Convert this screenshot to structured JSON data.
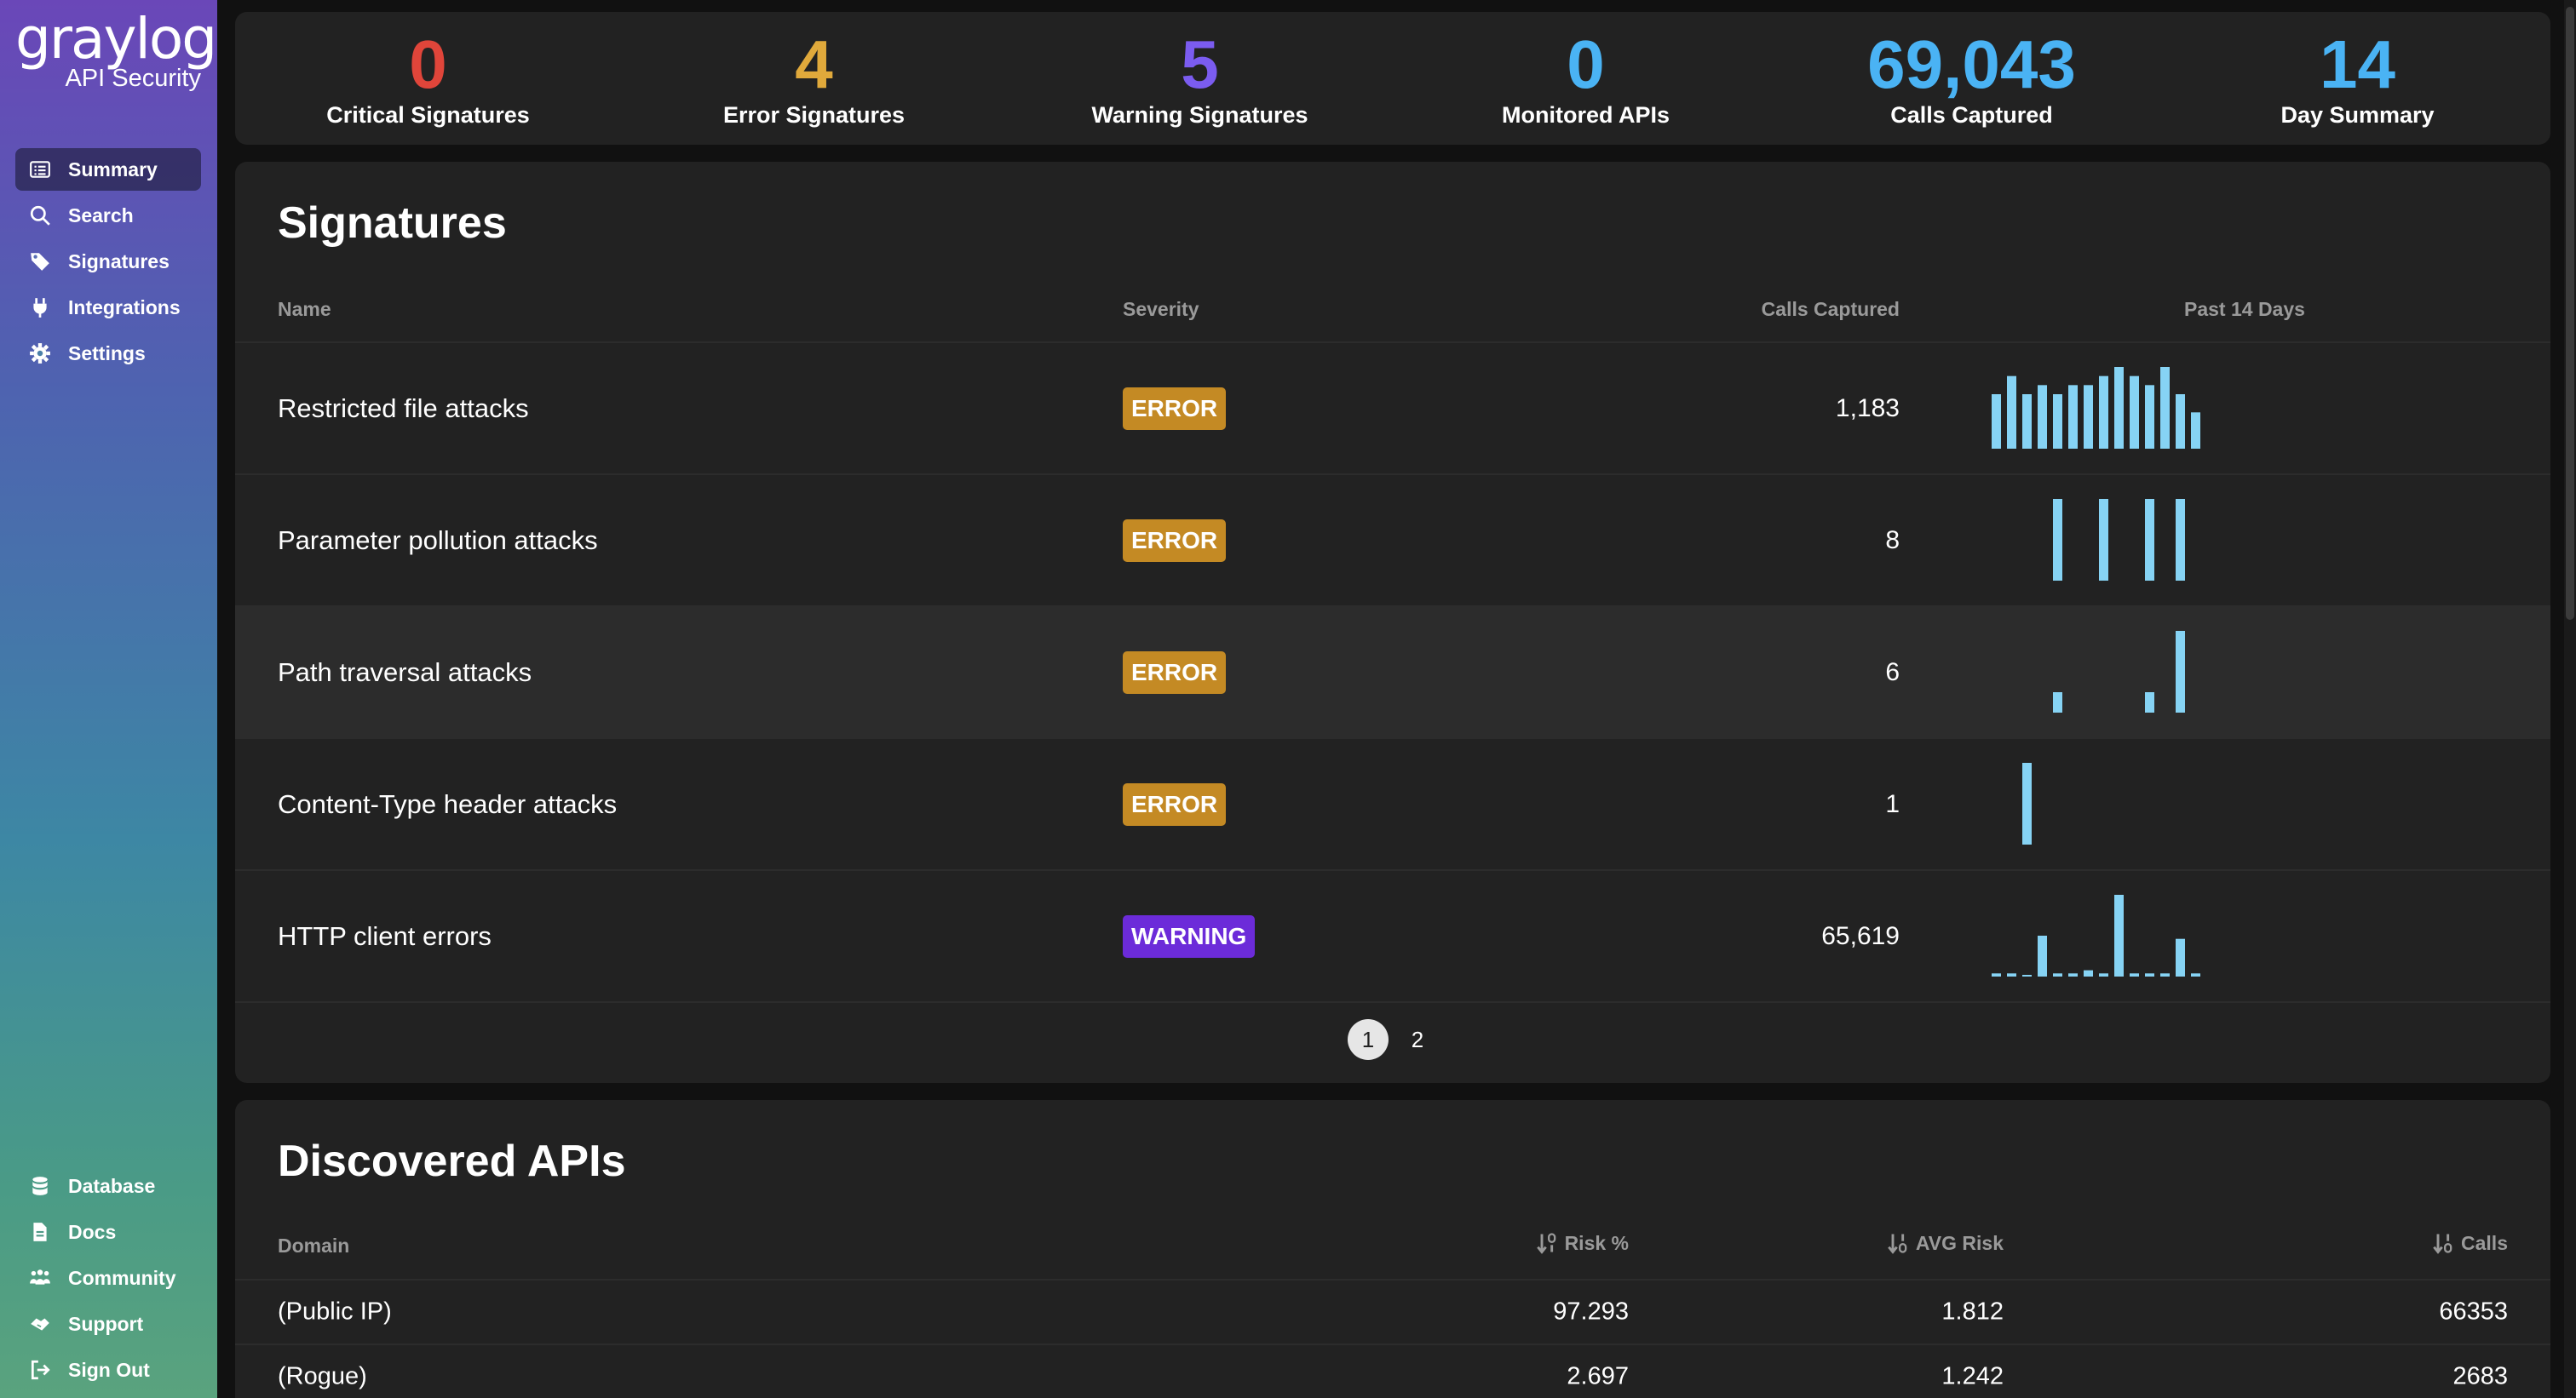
{
  "brand": {
    "name": "graylog",
    "product": "API Security"
  },
  "nav": {
    "top": [
      {
        "label": "Summary",
        "icon": "summary-icon",
        "active": true
      },
      {
        "label": "Search",
        "icon": "search-icon",
        "active": false
      },
      {
        "label": "Signatures",
        "icon": "tag-icon",
        "active": false
      },
      {
        "label": "Integrations",
        "icon": "plug-icon",
        "active": false
      },
      {
        "label": "Settings",
        "icon": "gear-icon",
        "active": false
      }
    ],
    "bottom": [
      {
        "label": "Database",
        "icon": "database-icon"
      },
      {
        "label": "Docs",
        "icon": "document-icon"
      },
      {
        "label": "Community",
        "icon": "people-icon"
      },
      {
        "label": "Support",
        "icon": "handshake-icon"
      },
      {
        "label": "Sign Out",
        "icon": "sign-out-icon"
      }
    ]
  },
  "stats": [
    {
      "value": "0",
      "label": "Critical Signatures",
      "color": "#e0453a"
    },
    {
      "value": "4",
      "label": "Error Signatures",
      "color": "#e0a93b"
    },
    {
      "value": "5",
      "label": "Warning Signatures",
      "color": "#7b5cf0"
    },
    {
      "value": "0",
      "label": "Monitored APIs",
      "color": "#4ab3f4"
    },
    {
      "value": "69,043",
      "label": "Calls Captured",
      "color": "#4ab3f4"
    },
    {
      "value": "14",
      "label": "Day Summary",
      "color": "#4ab3f4"
    }
  ],
  "signatures": {
    "title": "Signatures",
    "columns": {
      "name": "Name",
      "severity": "Severity",
      "calls": "Calls Captured",
      "trend": "Past 14 Days"
    },
    "rows": [
      {
        "name": "Restricted file attacks",
        "severity": "ERROR",
        "severity_color": "#c48a24",
        "calls": "1,183",
        "highlight": false,
        "trend": [
          6,
          8,
          6,
          7,
          6,
          7,
          7,
          8,
          9,
          8,
          7,
          9,
          6,
          4
        ]
      },
      {
        "name": "Parameter pollution attacks",
        "severity": "ERROR",
        "severity_color": "#c48a24",
        "calls": "8",
        "highlight": false,
        "trend": [
          0,
          0,
          0,
          0,
          2,
          0,
          0,
          2,
          0,
          0,
          2,
          0,
          2,
          0
        ]
      },
      {
        "name": "Path traversal attacks",
        "severity": "ERROR",
        "severity_color": "#c48a24",
        "calls": "6",
        "highlight": true,
        "trend": [
          0,
          0,
          0,
          0,
          0.5,
          0,
          0,
          0,
          0,
          0,
          0.5,
          0,
          2,
          0
        ]
      },
      {
        "name": "Content-Type header attacks",
        "severity": "ERROR",
        "severity_color": "#c48a24",
        "calls": "1",
        "highlight": false,
        "trend": [
          0,
          0,
          1,
          0,
          0,
          0,
          0,
          0,
          0,
          0,
          0,
          0,
          0,
          0
        ]
      },
      {
        "name": "HTTP client errors",
        "severity": "WARNING",
        "severity_color": "#6c2bd9",
        "calls": "65,619",
        "highlight": false,
        "trend": [
          1,
          1,
          0.5,
          13,
          1,
          1,
          2,
          1,
          26,
          1,
          1,
          1,
          12,
          1
        ]
      }
    ],
    "pages": [
      "1",
      "2"
    ],
    "current_page": "1"
  },
  "discovered": {
    "title": "Discovered APIs",
    "columns": {
      "domain": "Domain",
      "risk": "Risk %",
      "avg_risk": "AVG Risk",
      "calls": "Calls"
    },
    "rows": [
      {
        "domain": "(Public IP)",
        "risk": "97.293",
        "avg_risk": "1.812",
        "calls": "66353"
      },
      {
        "domain": "(Rogue)",
        "risk": "2.697",
        "avg_risk": "1.242",
        "calls": "2683"
      }
    ]
  },
  "chart_color": "#86d3f4"
}
